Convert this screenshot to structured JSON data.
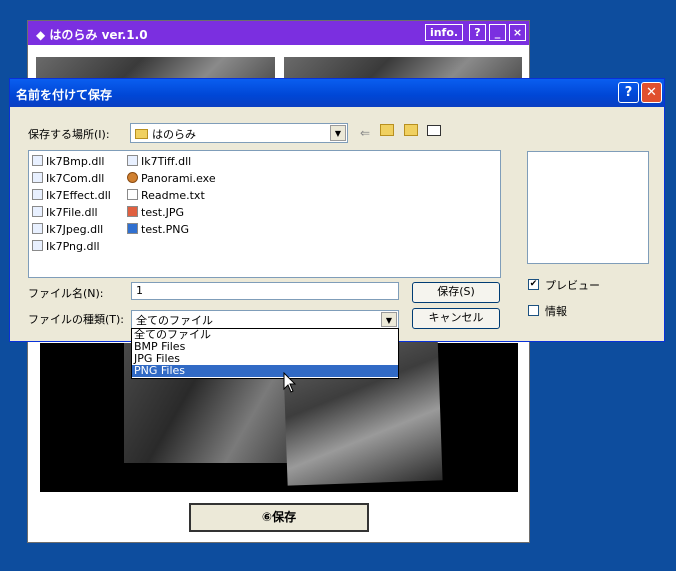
{
  "app": {
    "title": "◆ はのらみ ver.1.0",
    "btn_info": "info.",
    "btn_help": "?",
    "btn_min": "_",
    "btn_close": "×",
    "save_button": "⑥保存"
  },
  "dialog": {
    "title": "名前を付けて保存",
    "help": "?",
    "close": "✕",
    "location_label": "保存する場所(I):",
    "location_value": "はのらみ",
    "files": [
      {
        "name": "Ik7Bmp.dll",
        "type": "dll"
      },
      {
        "name": "Ik7Com.dll",
        "type": "dll"
      },
      {
        "name": "Ik7Effect.dll",
        "type": "dll"
      },
      {
        "name": "Ik7File.dll",
        "type": "dll"
      },
      {
        "name": "Ik7Jpeg.dll",
        "type": "dll"
      },
      {
        "name": "Ik7Png.dll",
        "type": "dll"
      },
      {
        "name": "Ik7Tiff.dll",
        "type": "dll"
      },
      {
        "name": "Panorami.exe",
        "type": "exe"
      },
      {
        "name": "Readme.txt",
        "type": "txt"
      },
      {
        "name": "test.JPG",
        "type": "jpg"
      },
      {
        "name": "test.PNG",
        "type": "png"
      }
    ],
    "filename_label": "ファイル名(N):",
    "filename_value": "1",
    "filetype_label": "ファイルの種類(T):",
    "filetype_value": "全てのファイル",
    "save_btn": "保存(S)",
    "cancel_btn": "キャンセル",
    "preview_label": "プレビュー",
    "preview_checked": true,
    "info_label": "情報",
    "info_checked": false,
    "filetype_options": [
      "全てのファイル",
      "BMP Files",
      "JPG Files",
      "PNG Files"
    ],
    "filetype_highlighted": "PNG Files"
  }
}
